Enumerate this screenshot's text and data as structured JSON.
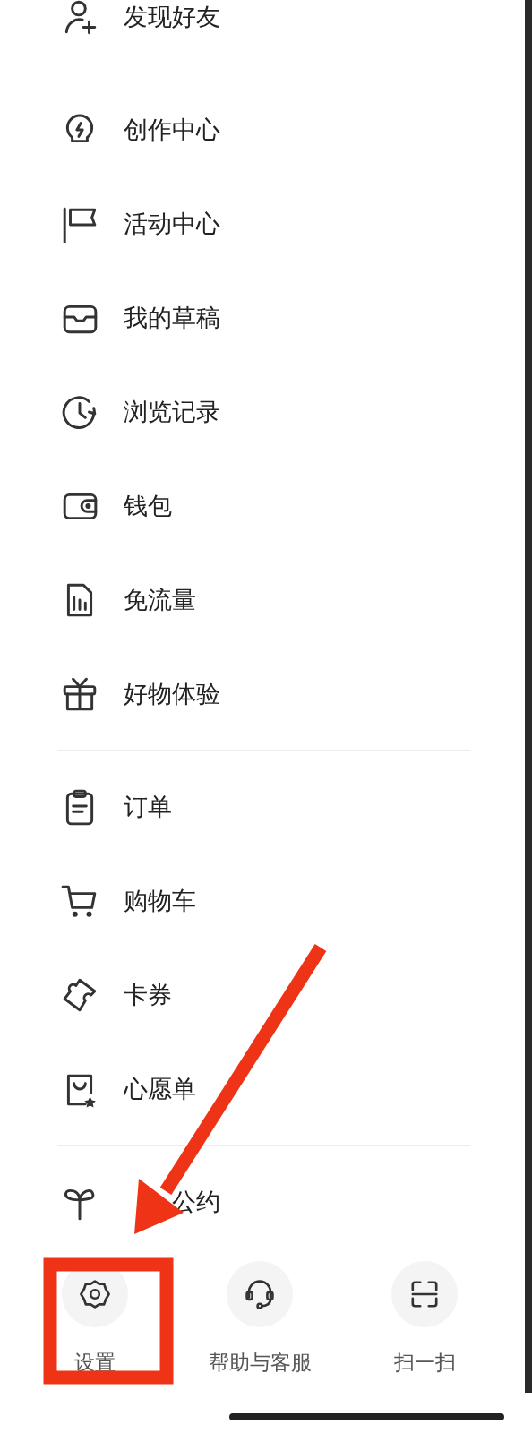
{
  "menu_sections": [
    {
      "items": [
        {
          "label": "发现好友"
        }
      ]
    },
    {
      "items": [
        {
          "label": "创作中心"
        },
        {
          "label": "活动中心"
        },
        {
          "label": "我的草稿"
        },
        {
          "label": "浏览记录"
        },
        {
          "label": "钱包"
        },
        {
          "label": "免流量"
        },
        {
          "label": "好物体验"
        }
      ]
    },
    {
      "items": [
        {
          "label": "订单"
        },
        {
          "label": "购物车"
        },
        {
          "label": "卡券"
        },
        {
          "label": "心愿单"
        }
      ]
    },
    {
      "items": [
        {
          "label": "公约",
          "obscured": true
        }
      ]
    }
  ],
  "bottom_actions": [
    {
      "label": "设置"
    },
    {
      "label": "帮助与客服"
    },
    {
      "label": "扫一扫"
    }
  ]
}
